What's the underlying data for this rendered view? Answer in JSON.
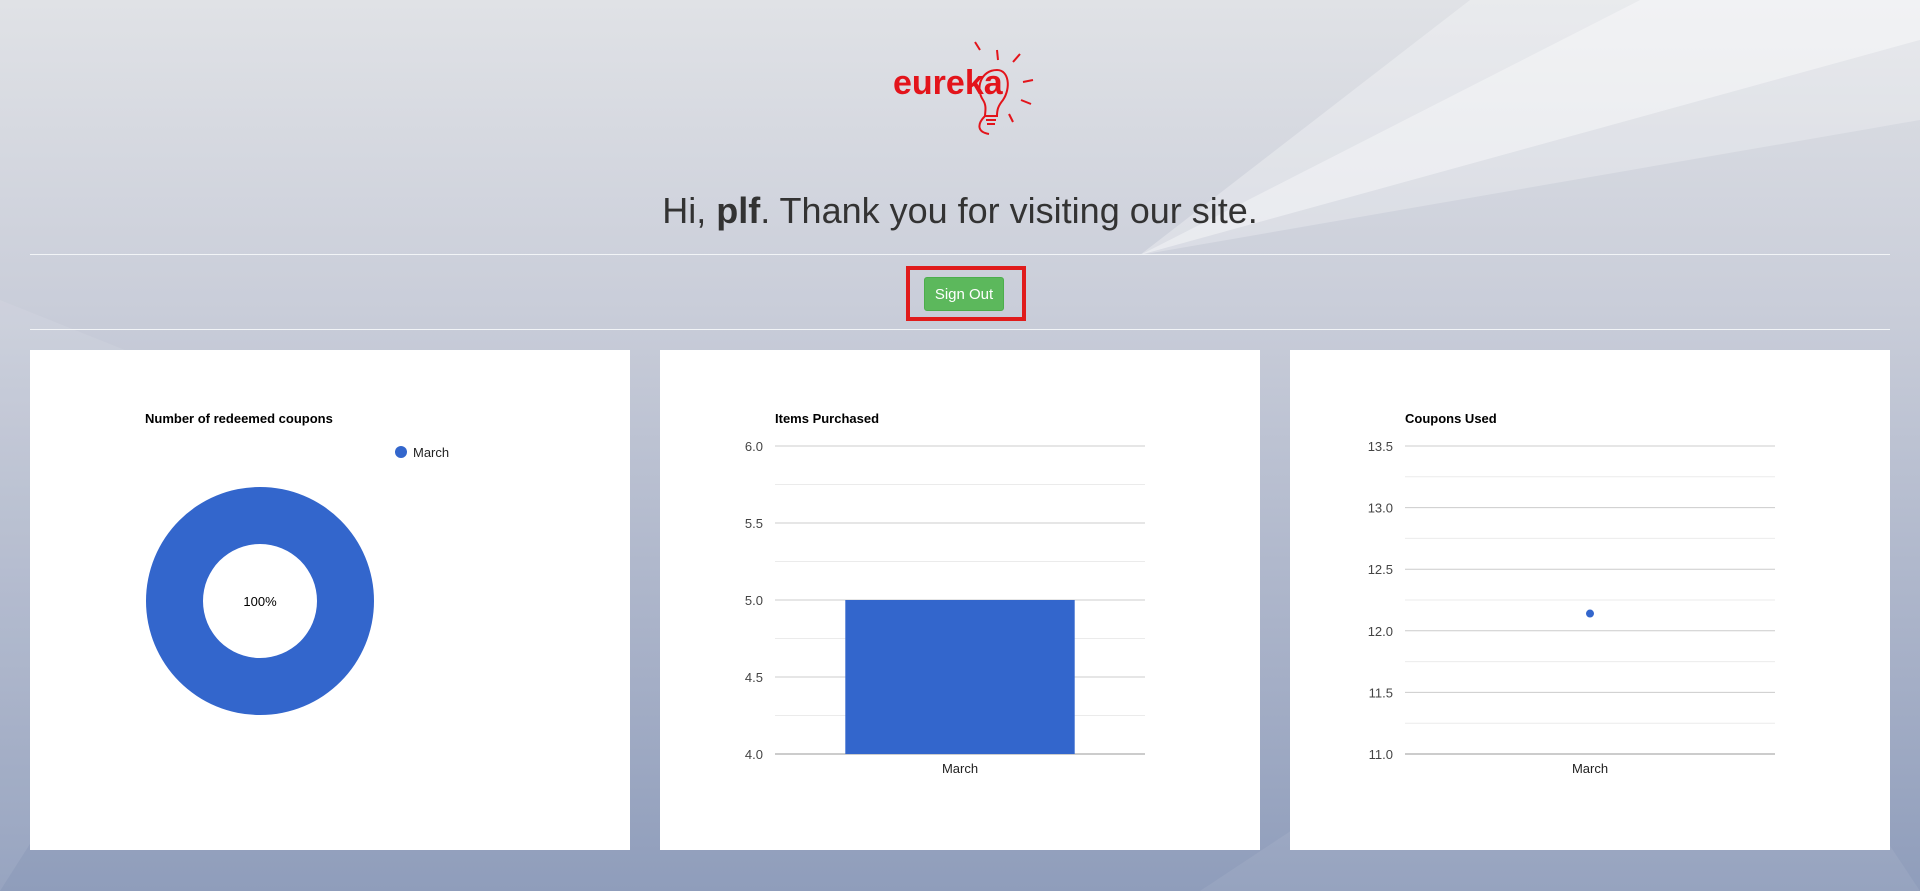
{
  "brand": {
    "logo_text": "eureka"
  },
  "greeting": {
    "prefix": "Hi, ",
    "user": "plf",
    "suffix": ". Thank you for visiting our site."
  },
  "actions": {
    "sign_out_label": "Sign Out"
  },
  "colors": {
    "series": "#3366cc",
    "button": "#5cb85c",
    "highlight": "#e01b1b",
    "logo": "#e3141b"
  },
  "chart_data": [
    {
      "type": "pie",
      "donut": true,
      "title": "Number of redeemed coupons",
      "categories": [
        "March"
      ],
      "values": [
        1
      ],
      "slice_labels": [
        "100%"
      ],
      "legend": [
        "March"
      ],
      "legend_position": "top-right"
    },
    {
      "type": "bar",
      "title": "Items Purchased",
      "categories": [
        "March"
      ],
      "values": [
        5
      ],
      "ylim": [
        4,
        6
      ],
      "yticks": [
        "6.0",
        "5.5",
        "5.0",
        "4.5",
        "4.0"
      ],
      "grid": true
    },
    {
      "type": "scatter",
      "title": "Coupons Used",
      "categories": [
        "March"
      ],
      "values": [
        12.14
      ],
      "ylim": [
        11,
        13.5
      ],
      "yticks": [
        "13.5",
        "13.0",
        "12.5",
        "12.0",
        "11.5",
        "11.0"
      ],
      "grid": true
    }
  ]
}
